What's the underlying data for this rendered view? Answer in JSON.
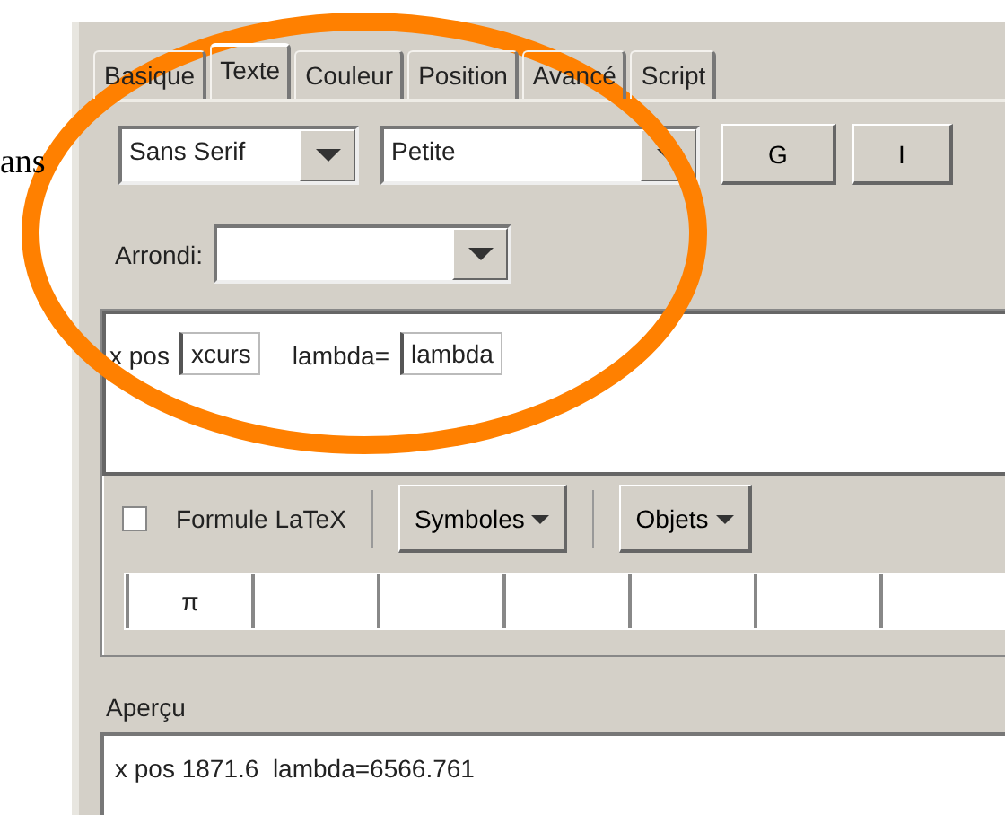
{
  "background_text": "ans",
  "tabs": [
    {
      "label": "Basique",
      "selected": false
    },
    {
      "label": "Texte",
      "selected": true
    },
    {
      "label": "Couleur",
      "selected": false
    },
    {
      "label": "Position",
      "selected": false
    },
    {
      "label": "Avancé",
      "selected": false
    },
    {
      "label": "Script",
      "selected": false
    }
  ],
  "font_family": {
    "value": "Sans Serif"
  },
  "font_size": {
    "value": "Petite"
  },
  "style_buttons": [
    {
      "label": "G"
    },
    {
      "label": "I"
    }
  ],
  "rounding": {
    "label": "Arrondi:"
  },
  "editor": {
    "parts": [
      {
        "kind": "text",
        "text": "x pos"
      },
      {
        "kind": "field",
        "text": "xcurs"
      },
      {
        "kind": "text",
        "text": "lambda="
      },
      {
        "kind": "field",
        "text": "lambda"
      }
    ]
  },
  "latex": {
    "label": "Formule LaTeX",
    "checked": false
  },
  "menus": [
    {
      "label": "Symboles"
    },
    {
      "label": "Objets"
    }
  ],
  "symbols": [
    "π"
  ],
  "preview": {
    "title": "Aperçu",
    "text": "x pos 1871.6  lambda=6566.761"
  }
}
